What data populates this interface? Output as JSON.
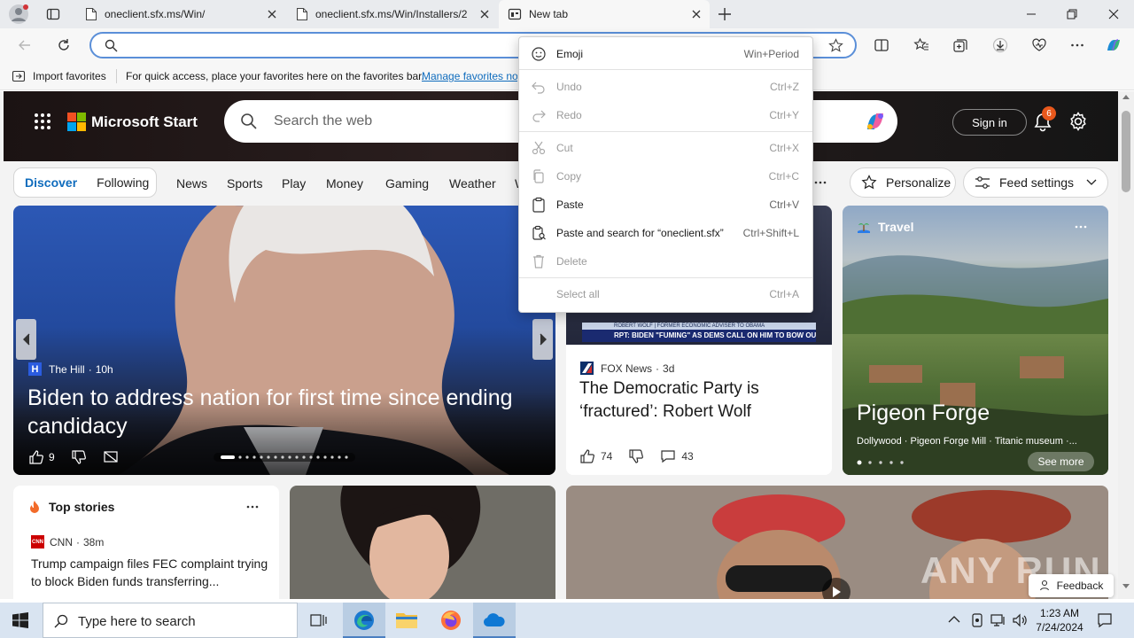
{
  "browser": {
    "tabs": [
      {
        "title": "oneclient.sfx.ms/Win/",
        "icon": "page-icon"
      },
      {
        "title": "oneclient.sfx.ms/Win/Installers/2",
        "icon": "page-icon"
      },
      {
        "title": "New tab",
        "icon": "newtab-icon"
      }
    ],
    "favorites_bar": {
      "import_label": "Import favorites",
      "hint_text": "For quick access, place your favorites here on the favorites bar.",
      "manage_link": "Manage favorites no"
    }
  },
  "context_menu": {
    "items": [
      {
        "label": "Emoji",
        "shortcut": "Win+Period",
        "enabled": true,
        "icon": "emoji-icon"
      },
      {
        "label": "Undo",
        "shortcut": "Ctrl+Z",
        "enabled": false,
        "icon": "undo-icon"
      },
      {
        "label": "Redo",
        "shortcut": "Ctrl+Y",
        "enabled": false,
        "icon": "redo-icon"
      },
      {
        "label": "Cut",
        "shortcut": "Ctrl+X",
        "enabled": false,
        "icon": "cut-icon"
      },
      {
        "label": "Copy",
        "shortcut": "Ctrl+C",
        "enabled": false,
        "icon": "copy-icon"
      },
      {
        "label": "Paste",
        "shortcut": "Ctrl+V",
        "enabled": true,
        "icon": "paste-icon"
      },
      {
        "label": "Paste and search for “oneclient.sfx”",
        "shortcut": "Ctrl+Shift+L",
        "enabled": true,
        "icon": "paste-search-icon"
      },
      {
        "label": "Delete",
        "shortcut": "",
        "enabled": false,
        "icon": "delete-icon"
      },
      {
        "label": "Select all",
        "shortcut": "Ctrl+A",
        "enabled": false,
        "icon": ""
      }
    ]
  },
  "msstart": {
    "brand": "Microsoft Start",
    "search_placeholder": "Search the web",
    "sign_in": "Sign in",
    "notifications_count": "6",
    "tabs": {
      "discover": "Discover",
      "following": "Following"
    },
    "nav": [
      "News",
      "Sports",
      "Play",
      "Money",
      "Gaming",
      "Weather",
      "W"
    ],
    "personalize": "Personalize",
    "feed_settings": "Feed settings"
  },
  "cards": {
    "main": {
      "source": "The Hill",
      "age": "10h",
      "headline": "Biden to address nation for first time since ending candidacy",
      "likes": "9"
    },
    "fox": {
      "source": "FOX News",
      "age": "3d",
      "headline": "The Democratic Party is ‘fractured’: Robert Wolf",
      "likes": "74",
      "comments": "43",
      "ticker_top": "ROBERT WOLF | FORMER ECONOMIC ADVISER TO OBAMA",
      "ticker_main": "RPT: BIDEN \"FUMING\" AS DEMS CALL ON HIM TO BOW OUT"
    },
    "travel": {
      "category": "Travel",
      "title": "Pigeon Forge",
      "subtitle": "Dollywood · Pigeon Forge Mill · Titanic museum ·...",
      "see_more": "See more"
    },
    "top_stories": {
      "title": "Top stories",
      "source": "CNN",
      "age": "38m",
      "headline": "Trump campaign files FEC complaint trying to block Biden funds transferring..."
    },
    "feedback": "Feedback",
    "watermark": "ANY RUN"
  },
  "taskbar": {
    "search_placeholder": "Type here to search",
    "time": "1:23 AM",
    "date": "7/24/2024"
  },
  "colors": {
    "accent": "#0f6cbd",
    "notification_badge": "#e8581c",
    "taskbar_bg": "#d9e4f1"
  }
}
